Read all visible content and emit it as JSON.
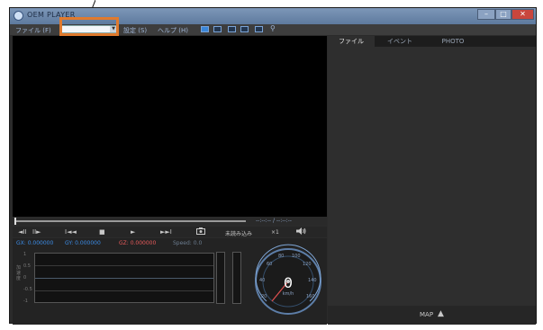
{
  "window": {
    "title": "OEM PLAYER",
    "controls": [
      "minimize-icon",
      "maximize-icon",
      "close-icon"
    ]
  },
  "menu": {
    "file": "ファイル (F)",
    "settings": "設定 (S)",
    "help": "ヘルプ (H)",
    "combo_value": ""
  },
  "layout_buttons": [
    "layout-1-icon",
    "layout-2-icon",
    "layout-3-icon",
    "layout-4-icon",
    "layout-5-icon",
    "zoom-icon"
  ],
  "player": {
    "time": "--:--:-- / --:--:--",
    "controls": {
      "prev_frame": "◄II",
      "next_frame": "II►",
      "skip_back": "I◄◄",
      "stop": "■",
      "play": "►",
      "skip_forward": "►►I",
      "camera": "camera-icon",
      "unread": "未読み込み",
      "speed": "×1",
      "volume": "speaker-icon"
    }
  },
  "gsensor": {
    "gx": "GX: 0.000000",
    "gy": "GY: 0.000000",
    "gz": "GZ: 0.000000",
    "speed": "Speed: 0.0",
    "y_ticks": [
      "1",
      "0.5",
      "0",
      "-0.5",
      "-1"
    ],
    "axis_label": "加速度",
    "colors": {
      "gx": "#3c8ce6",
      "gy": "#3c8ce6",
      "gz": "#e65a5a",
      "speed": "#6c7d90"
    }
  },
  "speedometer": {
    "value": "0",
    "unit": "km/h",
    "marks": [
      "20",
      "40",
      "60",
      "80",
      "100",
      "120",
      "140",
      "160"
    ]
  },
  "side_panel": {
    "tabs": [
      "ファイル",
      "イベント",
      "PHOTO"
    ],
    "active_tab": 0,
    "map_label": "MAP"
  },
  "annotation": {
    "highlight_color": "#e07a2e"
  }
}
